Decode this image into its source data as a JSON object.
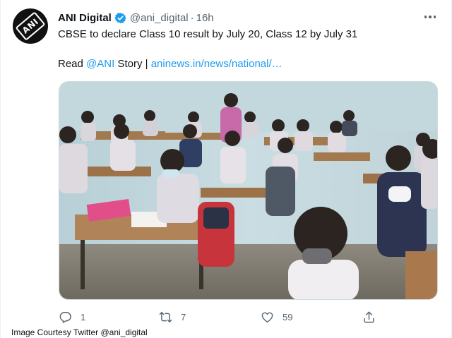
{
  "author": {
    "name": "ANI Digital",
    "handle": "@ani_digital",
    "separator": "·",
    "time": "16h",
    "avatar_text": "ANI",
    "verified_color": "#1d9bf0"
  },
  "tweet": {
    "text": "CBSE to declare Class 10 result by July 20, Class 12 by July 31",
    "read_prefix": "Read ",
    "mention": "@ANI",
    "story_label": " Story | ",
    "link_text": "aninews.in/news/national/…"
  },
  "actions": {
    "replies": "1",
    "retweets": "7",
    "likes": "59"
  },
  "icons": {
    "more": "more-horizontal-icon",
    "reply": "reply-icon",
    "retweet": "retweet-icon",
    "like": "heart-icon",
    "share": "share-icon"
  },
  "colors": {
    "link": "#1d9bf0",
    "secondary_text": "#536471",
    "primary_text": "#0f1419"
  },
  "credit": "Image Courtesy Twitter @ani_digital"
}
